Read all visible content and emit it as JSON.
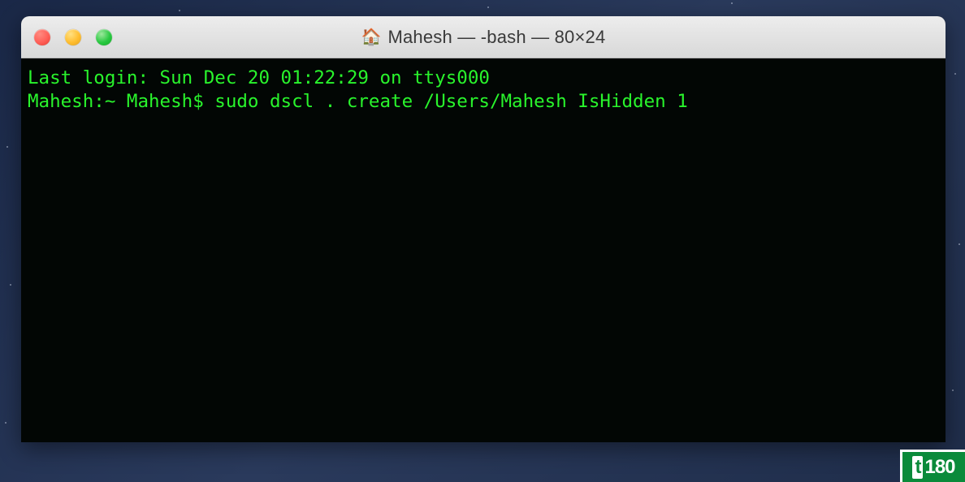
{
  "window": {
    "title": "Mahesh — -bash — 80×24",
    "home_icon": "🏠"
  },
  "terminal": {
    "lines": [
      "Last login: Sun Dec 20 01:22:29 on ttys000",
      "Mahesh:~ Mahesh$ sudo dscl . create /Users/Mahesh IsHidden 1"
    ]
  },
  "watermark": {
    "prefix": "t",
    "rest": "180"
  }
}
